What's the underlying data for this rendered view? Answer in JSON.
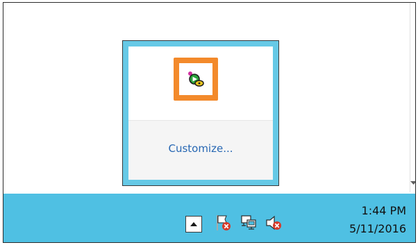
{
  "overflow_popup": {
    "icons": [
      {
        "name": "media-player-tray-icon",
        "highlighted": true
      }
    ],
    "customize_label": "Customize...",
    "highlight_color": "#f38a2b",
    "frame_color": "#66c9e6"
  },
  "taskbar": {
    "background_color": "#4fc0e3",
    "show_hidden_icon": "chevron-up-icon",
    "tray_icons": [
      "action-center-flag-icon",
      "network-icon",
      "volume-muted-icon"
    ],
    "clock": {
      "time": "1:44 PM",
      "date": "5/11/2016"
    }
  }
}
